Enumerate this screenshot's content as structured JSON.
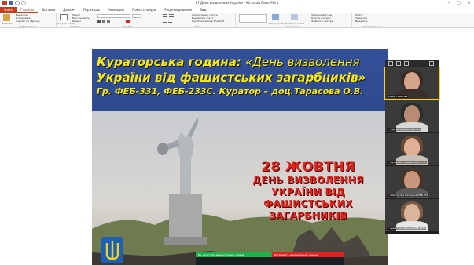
{
  "window": {
    "title": "07 День визволення Укрaїни - Microsoft PowerPoint",
    "controls": [
      "–",
      "□",
      "×"
    ]
  },
  "ribbon_tabs": [
    "Файл",
    "Главная",
    "Вставка",
    "Дизайн",
    "Переходы",
    "Анимация",
    "Показ слайдов",
    "Рецензирование",
    "Вид"
  ],
  "ribbon": {
    "clipboard": {
      "paste": "Вставить",
      "cut": "Вырезать",
      "copy": "Копировать",
      "format": "Формат по образцу",
      "label": "Буфер обмена"
    },
    "slides": {
      "new_slide": "Создать слайд",
      "layout": "Макет",
      "reset": "Восстановить",
      "section": "Раздел",
      "label": "Слайды"
    },
    "font": {
      "label": "Шрифт"
    },
    "paragraph": {
      "direction": "Направление текста",
      "align": "Выровнять текст",
      "smartart": "Преобразовать в SmartArt",
      "label": "Абзац"
    },
    "drawing": {
      "arrange": "Упорядочить",
      "quick_styles": "Экспресс-стили",
      "fill": "Заливка фигуры",
      "outline": "Контур фигуры",
      "effects": "Эффекты фигуры",
      "label": "Рисование"
    },
    "editing": {
      "find": "Найти",
      "replace": "Заменить",
      "select": "Выделить",
      "label": "Редактирование"
    }
  },
  "slide": {
    "title": "Кураторська година: «День визволення України від фашистських загарбників»",
    "title_part1": "Кураторська година:",
    "title_part2": "«День визволення",
    "title_line2": "України від фашистських загарбників»",
    "subtitle": "Гр. ФЕБ-331, ФЕБ-233С. Куратор – доц.Тарасова О.В.",
    "poster_lines": [
      "28 ЖОВТНЯ",
      "ДЕНЬ ВИЗВОЛЕННЯ",
      "УКРАЇНИ ВІД",
      "ФАШИСТСЬКИХ",
      "ЗАГАРБНИКІВ"
    ],
    "share_bar": {
      "sharing_text": "Вы запустили демонстрацию экрана",
      "stop_text": "Остановить демонстрацию экрана",
      "green": "#1db34a",
      "red": "#e02222"
    }
  },
  "zoom_panel": {
    "participants": [
      {
        "name": "Олена Тарасова",
        "active": true
      },
      {
        "name": "Сергей Бевдей ФЕБ-331",
        "active": false
      },
      {
        "name": "Катерина Тельник ФЕБ-233С",
        "active": false
      },
      {
        "name": "Шостакова Катерина ФЕБ-331",
        "active": false
      },
      {
        "name": "Анна Генглевська ФЕБ-233С",
        "active": false
      }
    ]
  },
  "colors": {
    "accent": "#c43e1c",
    "slide_header": "#2f4a90",
    "title_text": "#f6e818",
    "poster_text": "#e0241b"
  }
}
